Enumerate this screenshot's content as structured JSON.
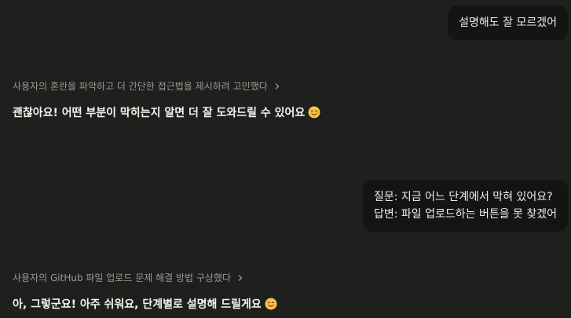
{
  "conversation": {
    "user_message_1": "설명해도 잘 모르겠어",
    "thinking_1": "사용자의 혼란을 파악하고 더 간단한 접근법을 제시하려 고민했다",
    "assistant_message_1": "괜찮아요! 어떤 부분이 막히는지 알면 더 잘 도와드릴 수 있어요",
    "user_message_2_line_1": "질문: 지금 어느 단계에서 막혀 있어요?",
    "user_message_2_line_2": "답변: 파일 업로드하는 버튼을 못 찾겠어",
    "thinking_2": "사용자의 GitHub 파일 업로드 문제 해결 방법 구상했다",
    "assistant_message_2": "아, 그렇군요! 아주 쉬워요, 단계별로 설명해 드릴게요"
  },
  "icons": {
    "expand": "chevron-right-icon",
    "emoji": "smiling-face-icon"
  },
  "colors": {
    "background": "#1f1f1e",
    "user_bubble": "#141413",
    "thinking_text": "#9a9993",
    "assistant_text": "#f4f4ef",
    "emoji_face": "#f5c542"
  }
}
